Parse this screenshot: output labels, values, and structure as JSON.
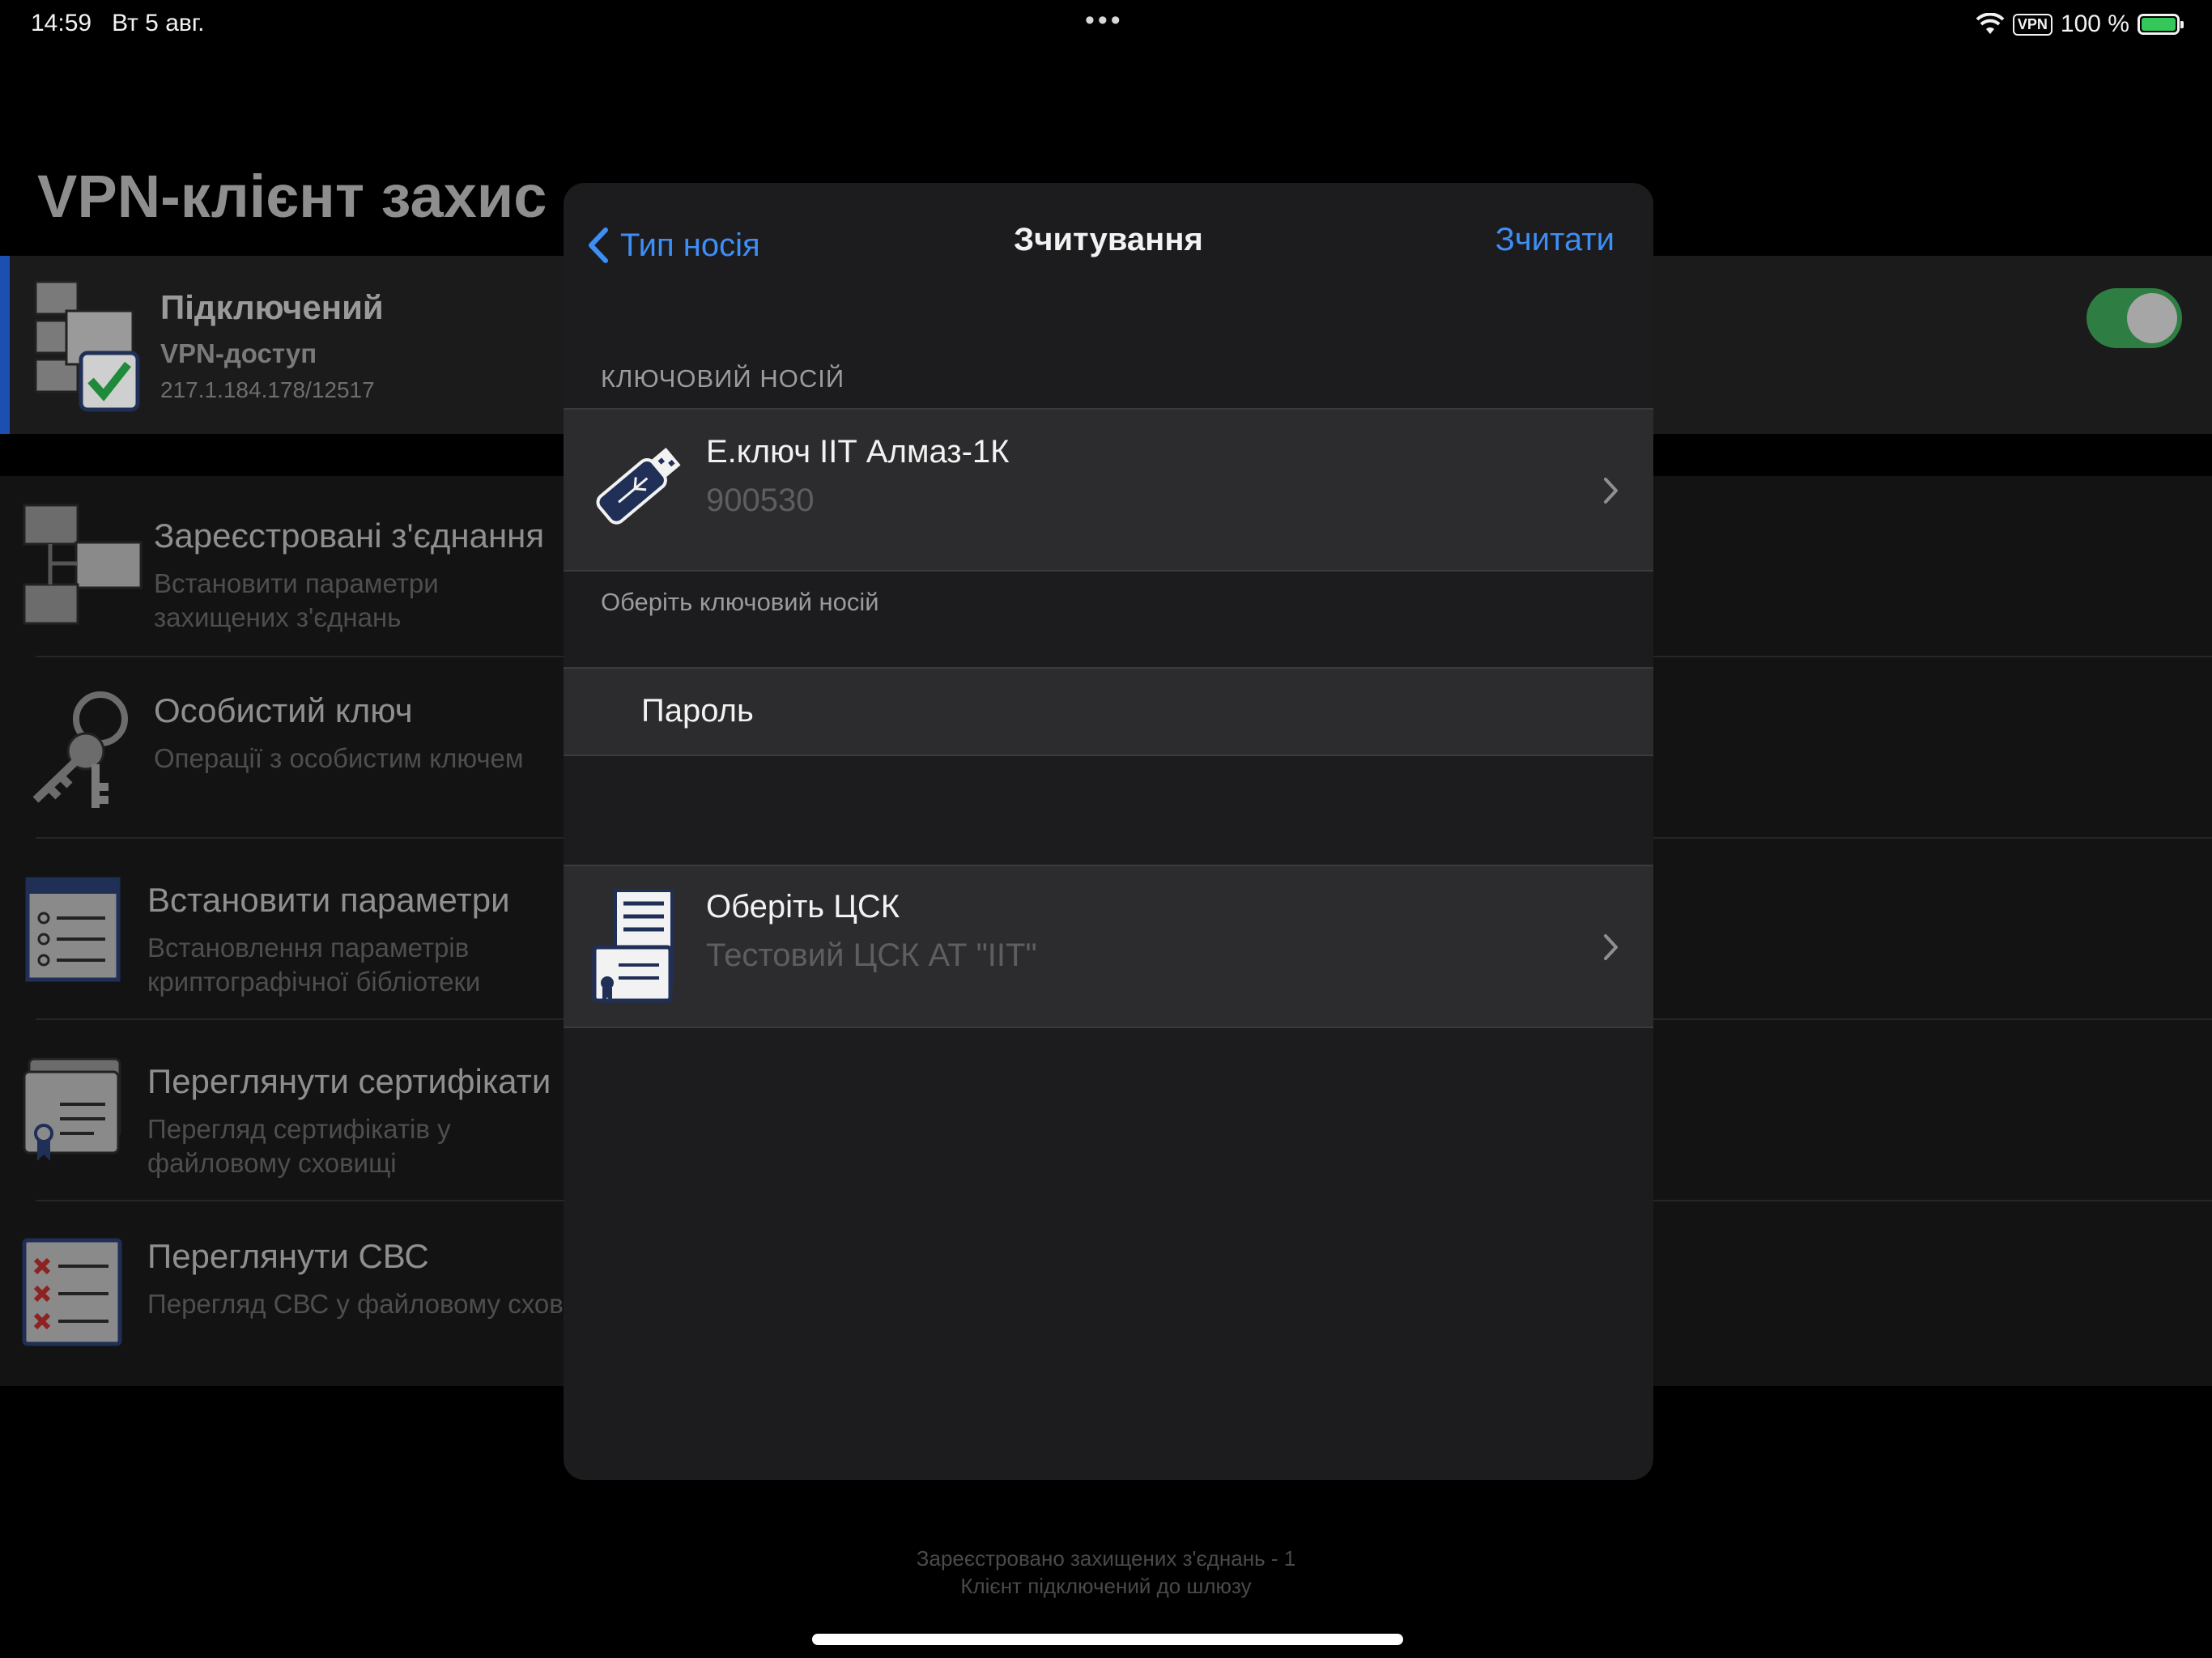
{
  "status_bar": {
    "time": "14:59",
    "date": "Вт 5 авг.",
    "dots": "•••",
    "vpn": "VPN",
    "battery": "100 %"
  },
  "background": {
    "title": "VPN-клієнт захис",
    "connection": {
      "name": "Підключений",
      "type": "VPN-доступ",
      "address": "217.1.184.178/12517",
      "toggle_on": true
    },
    "menu": [
      {
        "title": "Зареєстровані з'єднання",
        "subtitle": [
          "Встановити параметри",
          "захищених з'єднань"
        ],
        "icon": "network-computers-icon"
      },
      {
        "title": "Особистий ключ",
        "subtitle": [
          "Операції з особистим ключем"
        ],
        "icon": "keys-icon"
      },
      {
        "title": "Встановити параметри",
        "subtitle": [
          "Встановлення параметрів",
          "криптографічної бібліотеки"
        ],
        "icon": "settings-list-icon"
      },
      {
        "title": "Переглянути сертифікати",
        "subtitle": [
          "Перегляд сертифікатів у",
          "файловому сховищі"
        ],
        "icon": "certificates-icon"
      },
      {
        "title": "Переглянути СВС",
        "subtitle": [
          "Перегляд СВС у файловому сховищі"
        ],
        "icon": "revoked-list-icon"
      }
    ],
    "footer": {
      "line1": "Зареєстровано захищених з'єднань - 1",
      "line2": "Клієнт підключений до шлюзу"
    }
  },
  "modal": {
    "back_label": "Тип носія",
    "title": "Зчитування",
    "action_label": "Зчитати",
    "key_section_header": "КЛЮЧОВИЙ НОСІЙ",
    "key_device": {
      "name": "Е.ключ ІІТ Алмаз-1К",
      "serial": "900530",
      "icon": "usb-key-icon"
    },
    "key_section_footer": "Оберіть ключовий носій",
    "password_label": "Пароль",
    "ca": {
      "title": "Оберіть ЦСК",
      "value": "Тестовий ЦСК АТ \"ІІТ\"",
      "icon": "ca-server-icon"
    }
  },
  "colors": {
    "accent": "#3d8ef5",
    "toggle_on": "#2e7d43",
    "connection_bar": "#1d4fb0",
    "battery": "#35c759"
  }
}
